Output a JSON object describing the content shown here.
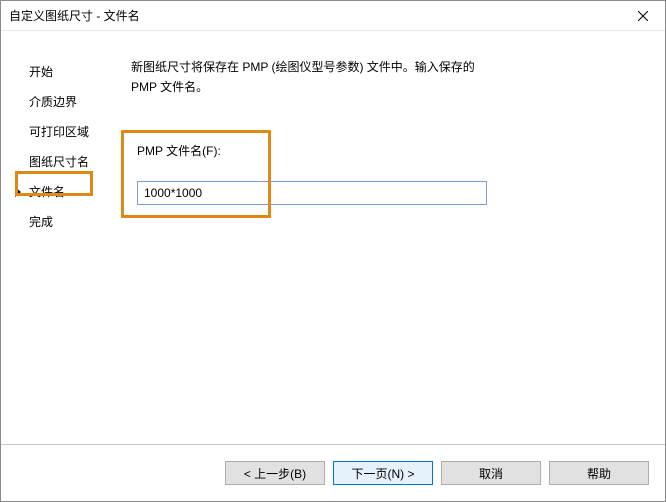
{
  "window": {
    "title": "自定义图纸尺寸 - 文件名"
  },
  "sidebar": {
    "items": [
      {
        "label": "开始"
      },
      {
        "label": "介质边界"
      },
      {
        "label": "可打印区域"
      },
      {
        "label": "图纸尺寸名"
      },
      {
        "label": "文件名"
      },
      {
        "label": "完成"
      }
    ],
    "activeIndex": 4
  },
  "main": {
    "description": "新图纸尺寸将保存在 PMP (绘图仪型号参数) 文件中。输入保存的 PMP 文件名。",
    "field_label": "PMP 文件名(F):",
    "field_value": "1000*1000"
  },
  "footer": {
    "back": "< 上一步(B)",
    "next": "下一页(N) >",
    "cancel": "取消",
    "help": "帮助"
  }
}
